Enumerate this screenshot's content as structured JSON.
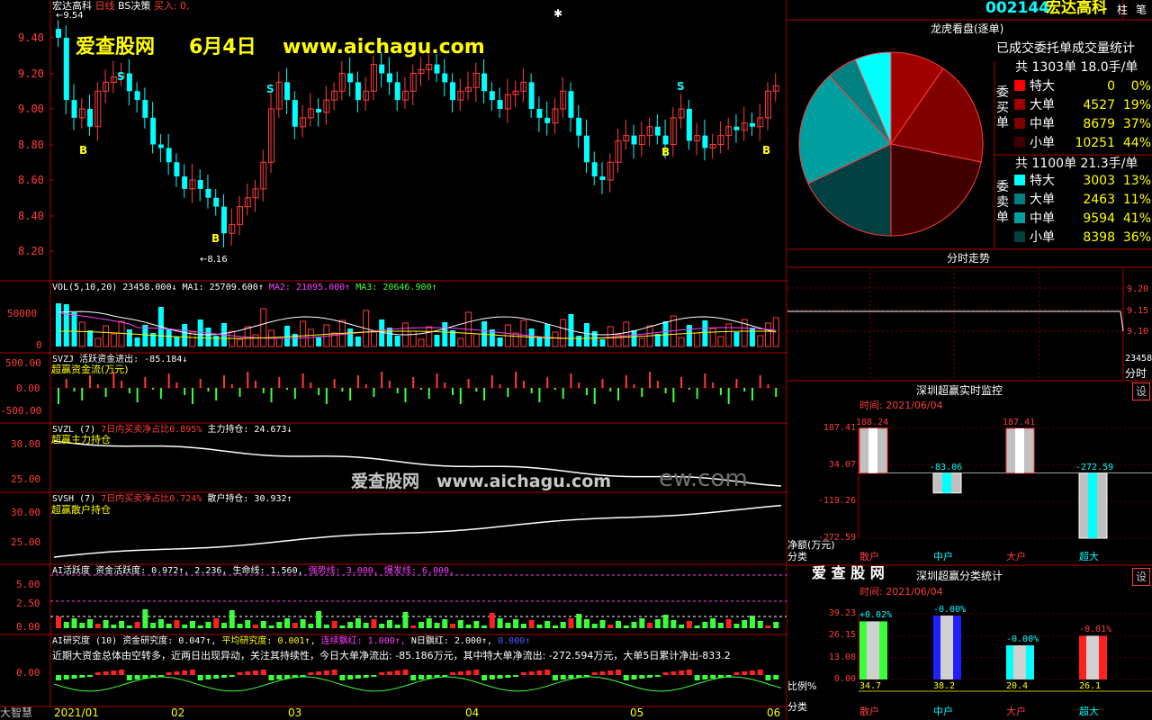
{
  "header": {
    "stock_name": "宏达高科",
    "line_type": "日线",
    "strategy": "BS决策",
    "buy_label": "买入: 0,",
    "high_price": "9.54",
    "low_price": "8.16",
    "stock_code": "002144",
    "mode_btn_1": "柱",
    "mode_btn_2": "笔"
  },
  "watermarks": {
    "site_cn": "爱查股网",
    "date": "6月4日",
    "url": "www.aichagu.com",
    "mid_text": "爱查股网　www.aichagu.com",
    "mid_tail": "ew.com",
    "ai_brand": "爱 查 股 网"
  },
  "price_axis": [
    "9.40",
    "9.20",
    "9.00",
    "8.80",
    "8.60",
    "8.40",
    "8.20"
  ],
  "signals": {
    "buy": "B",
    "sell": "S"
  },
  "panels": {
    "vol": {
      "label": "VOL(5,10,20)",
      "value": "23458.000↓",
      "ma1": "MA1: 25709.600↑",
      "ma2": "MA2: 21095.000↑",
      "ma3": "MA3: 20646.900↑",
      "axis": [
        "50000",
        "0"
      ]
    },
    "svzj": {
      "label": "SVZJ",
      "title": "活跃资金进出: -85.184↓",
      "subtitle": "超赢资金流(万元)",
      "axis": [
        "500.00",
        "0.00",
        "-500.00"
      ]
    },
    "svzl": {
      "label": "SVZL (7)",
      "desc": "7日内买卖净占比0.895%",
      "value": "主力持仓: 24.673↓",
      "subtitle": "超赢主力持仓",
      "axis": [
        "30.00",
        "25.00"
      ]
    },
    "svsh": {
      "label": "SVSH (7)",
      "desc": "7日内买卖净占比0.724%",
      "value": "散户持仓: 30.932↑",
      "subtitle": "超赢散户持仓",
      "axis": [
        "30.00",
        "25.00"
      ]
    },
    "ai_active": {
      "label": "AI活跃度",
      "v1": "资金活跃度: 0.972↑,",
      "v2": "2.236,",
      "v3": "生命线: 1.560,",
      "v4": "强势线: 3.000,",
      "v5": "爆发线: 6.000,",
      "axis": [
        "5.00",
        "2.50",
        "0.00"
      ]
    },
    "ai_research": {
      "label": "AI研究度 (10)",
      "v1": "资金研究度: 0.047↑,",
      "v2": "平均研究度: 0.001↑,",
      "v3": "连续飘红: 1.000↑,",
      "v4": "N日飘红: 2.000↑,",
      "v5": "0.000↑",
      "comment": "近期大资金总体由空转多，近两日出现异动，关注其持续性，今日大单净流出: -85.186万元，其中特大单净流出: -272.594万元，大单5日累计净出-833.2",
      "axis": [
        "0.00"
      ]
    }
  },
  "bottom_left": "大智慧",
  "dates": [
    "2021/01",
    "02",
    "03",
    "04",
    "05",
    "06"
  ],
  "dragon": {
    "title": "龙虎看盘(逐单)",
    "stat_title": "已成交委托单成交量统计",
    "buy_side": "委买单",
    "sell_side": "委卖单",
    "buy_total": "共 1303单 18.0手/单",
    "sell_total": "共 1100单 21.3手/单",
    "buy_rows": [
      {
        "name": "特大",
        "count": "0",
        "pct": "0%",
        "color": "#ff0000"
      },
      {
        "name": "大单",
        "count": "4527",
        "pct": "19%",
        "color": "#a00000"
      },
      {
        "name": "中单",
        "count": "8679",
        "pct": "37%",
        "color": "#800000"
      },
      {
        "name": "小单",
        "count": "10251",
        "pct": "44%",
        "color": "#400000"
      }
    ],
    "sell_rows": [
      {
        "name": "特大",
        "count": "3003",
        "pct": "13%",
        "color": "#00ffff"
      },
      {
        "name": "大单",
        "count": "2463",
        "pct": "11%",
        "color": "#008080"
      },
      {
        "name": "中单",
        "count": "9594",
        "pct": "41%",
        "color": "#00a0a0"
      },
      {
        "name": "小单",
        "count": "8398",
        "pct": "36%",
        "color": "#004040"
      }
    ]
  },
  "intraday": {
    "title": "分时走势",
    "prices": [
      "9.20",
      "9.15",
      "9.10"
    ],
    "vol_label": "23458",
    "time_label": "分时"
  },
  "monitor": {
    "title": "深圳超赢实时监控",
    "time_label": "时间: 2021/06/04",
    "set": "设",
    "axis_labels": [
      "187.41",
      "34.07",
      "-119.26",
      "-272.59"
    ],
    "unit": "净额(万元)",
    "cat_label": "分类",
    "categories": [
      "散户",
      "中户",
      "大户",
      "超大"
    ],
    "values": [
      "188.24",
      "-83.06",
      "187.41",
      "-272.59"
    ]
  },
  "classstat": {
    "title": "深圳超赢分类统计",
    "time_label": "时间: 2021/06/04",
    "set": "设",
    "axis_labels": [
      "39.23",
      "26.15",
      "13.08",
      "0.00"
    ],
    "unit": "比例%",
    "cat_label": "分类",
    "categories": [
      "散户",
      "中户",
      "大户",
      "超大"
    ],
    "changes": [
      "+0.02%",
      "-0.00%",
      "-0.00%",
      "-0.01%"
    ],
    "values": [
      "34.7",
      "38.2",
      "20.4",
      "26.1"
    ]
  },
  "chart_data": [
    {
      "type": "pie",
      "title": "已成交委托单成交量统计",
      "labels": [
        "委买特大",
        "委买大单",
        "委买中单",
        "委买小单",
        "委卖特大",
        "委卖大单",
        "委卖中单",
        "委卖小单"
      ],
      "values": [
        0,
        4527,
        8679,
        10251,
        3003,
        2463,
        9594,
        8398
      ]
    },
    {
      "type": "bar",
      "title": "深圳超赢实时监控",
      "categories": [
        "散户",
        "中户",
        "大户",
        "超大"
      ],
      "values": [
        188.24,
        -83.06,
        187.41,
        -272.59
      ],
      "ylabel": "净额(万元)",
      "ylim": [
        -272.59,
        187.41
      ]
    },
    {
      "type": "bar",
      "title": "深圳超赢分类统计",
      "categories": [
        "散户",
        "中户",
        "大户",
        "超大"
      ],
      "values": [
        34.7,
        38.2,
        20.4,
        26.1
      ],
      "ylabel": "比例%",
      "ylim": [
        0,
        39.23
      ]
    }
  ]
}
